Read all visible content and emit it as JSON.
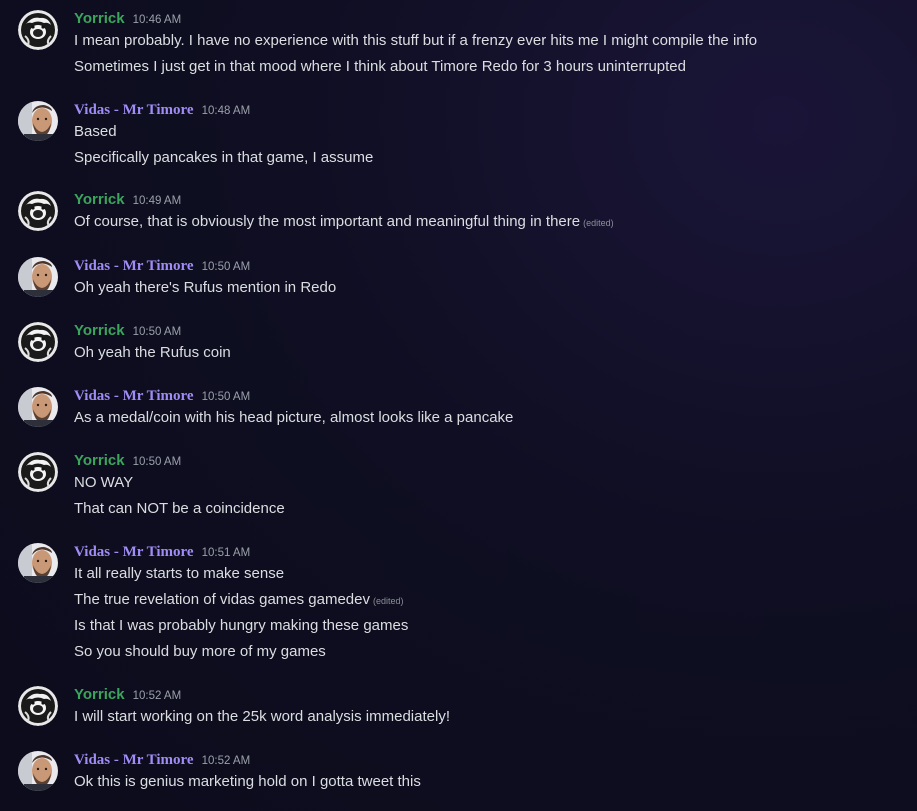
{
  "messages": [
    {
      "author": "Yorrick",
      "author_kind": "yorrick",
      "time": "10:46 AM",
      "lines": [
        {
          "text": "I mean probably. I have no experience with this stuff but if a frenzy ever hits me I might compile the info",
          "edited": ""
        },
        {
          "text": "Sometimes I just get in that mood where I think about Timore Redo for 3 hours uninterrupted",
          "edited": ""
        }
      ]
    },
    {
      "author": "Vidas - Mr Timore",
      "author_kind": "vidas",
      "time": "10:48 AM",
      "lines": [
        {
          "text": "Based",
          "edited": ""
        },
        {
          "text": "Specifically pancakes in that game, I assume",
          "edited": ""
        }
      ]
    },
    {
      "author": "Yorrick",
      "author_kind": "yorrick",
      "time": "10:49 AM",
      "lines": [
        {
          "text": "Of course, that is obviously the most important and meaningful thing in there",
          "edited": "(edited)"
        }
      ]
    },
    {
      "author": "Vidas - Mr Timore",
      "author_kind": "vidas",
      "time": "10:50 AM",
      "lines": [
        {
          "text": "Oh yeah there's Rufus mention in Redo",
          "edited": ""
        }
      ]
    },
    {
      "author": "Yorrick",
      "author_kind": "yorrick",
      "time": "10:50 AM",
      "lines": [
        {
          "text": "Oh yeah the Rufus coin",
          "edited": ""
        }
      ]
    },
    {
      "author": "Vidas - Mr Timore",
      "author_kind": "vidas",
      "time": "10:50 AM",
      "lines": [
        {
          "text": "As a medal/coin with his head picture, almost looks like a pancake",
          "edited": ""
        }
      ]
    },
    {
      "author": "Yorrick",
      "author_kind": "yorrick",
      "time": "10:50 AM",
      "lines": [
        {
          "text": "NO WAY",
          "edited": ""
        },
        {
          "text": "That can NOT be a coincidence",
          "edited": ""
        }
      ]
    },
    {
      "author": "Vidas - Mr Timore",
      "author_kind": "vidas",
      "time": "10:51 AM",
      "lines": [
        {
          "text": "It all really starts to make sense",
          "edited": ""
        },
        {
          "text": "The true revelation of vidas games gamedev",
          "edited": "(edited)"
        },
        {
          "text": "Is that I was probably hungry making these games",
          "edited": ""
        },
        {
          "text": "So you should buy more of my games",
          "edited": ""
        }
      ]
    },
    {
      "author": "Yorrick",
      "author_kind": "yorrick",
      "time": "10:52 AM",
      "lines": [
        {
          "text": "I will start working on the 25k word analysis immediately!",
          "edited": ""
        }
      ]
    },
    {
      "author": "Vidas - Mr Timore",
      "author_kind": "vidas",
      "time": "10:52 AM",
      "lines": [
        {
          "text": "Ok this is genius marketing hold on I gotta tweet this",
          "edited": ""
        }
      ]
    }
  ]
}
